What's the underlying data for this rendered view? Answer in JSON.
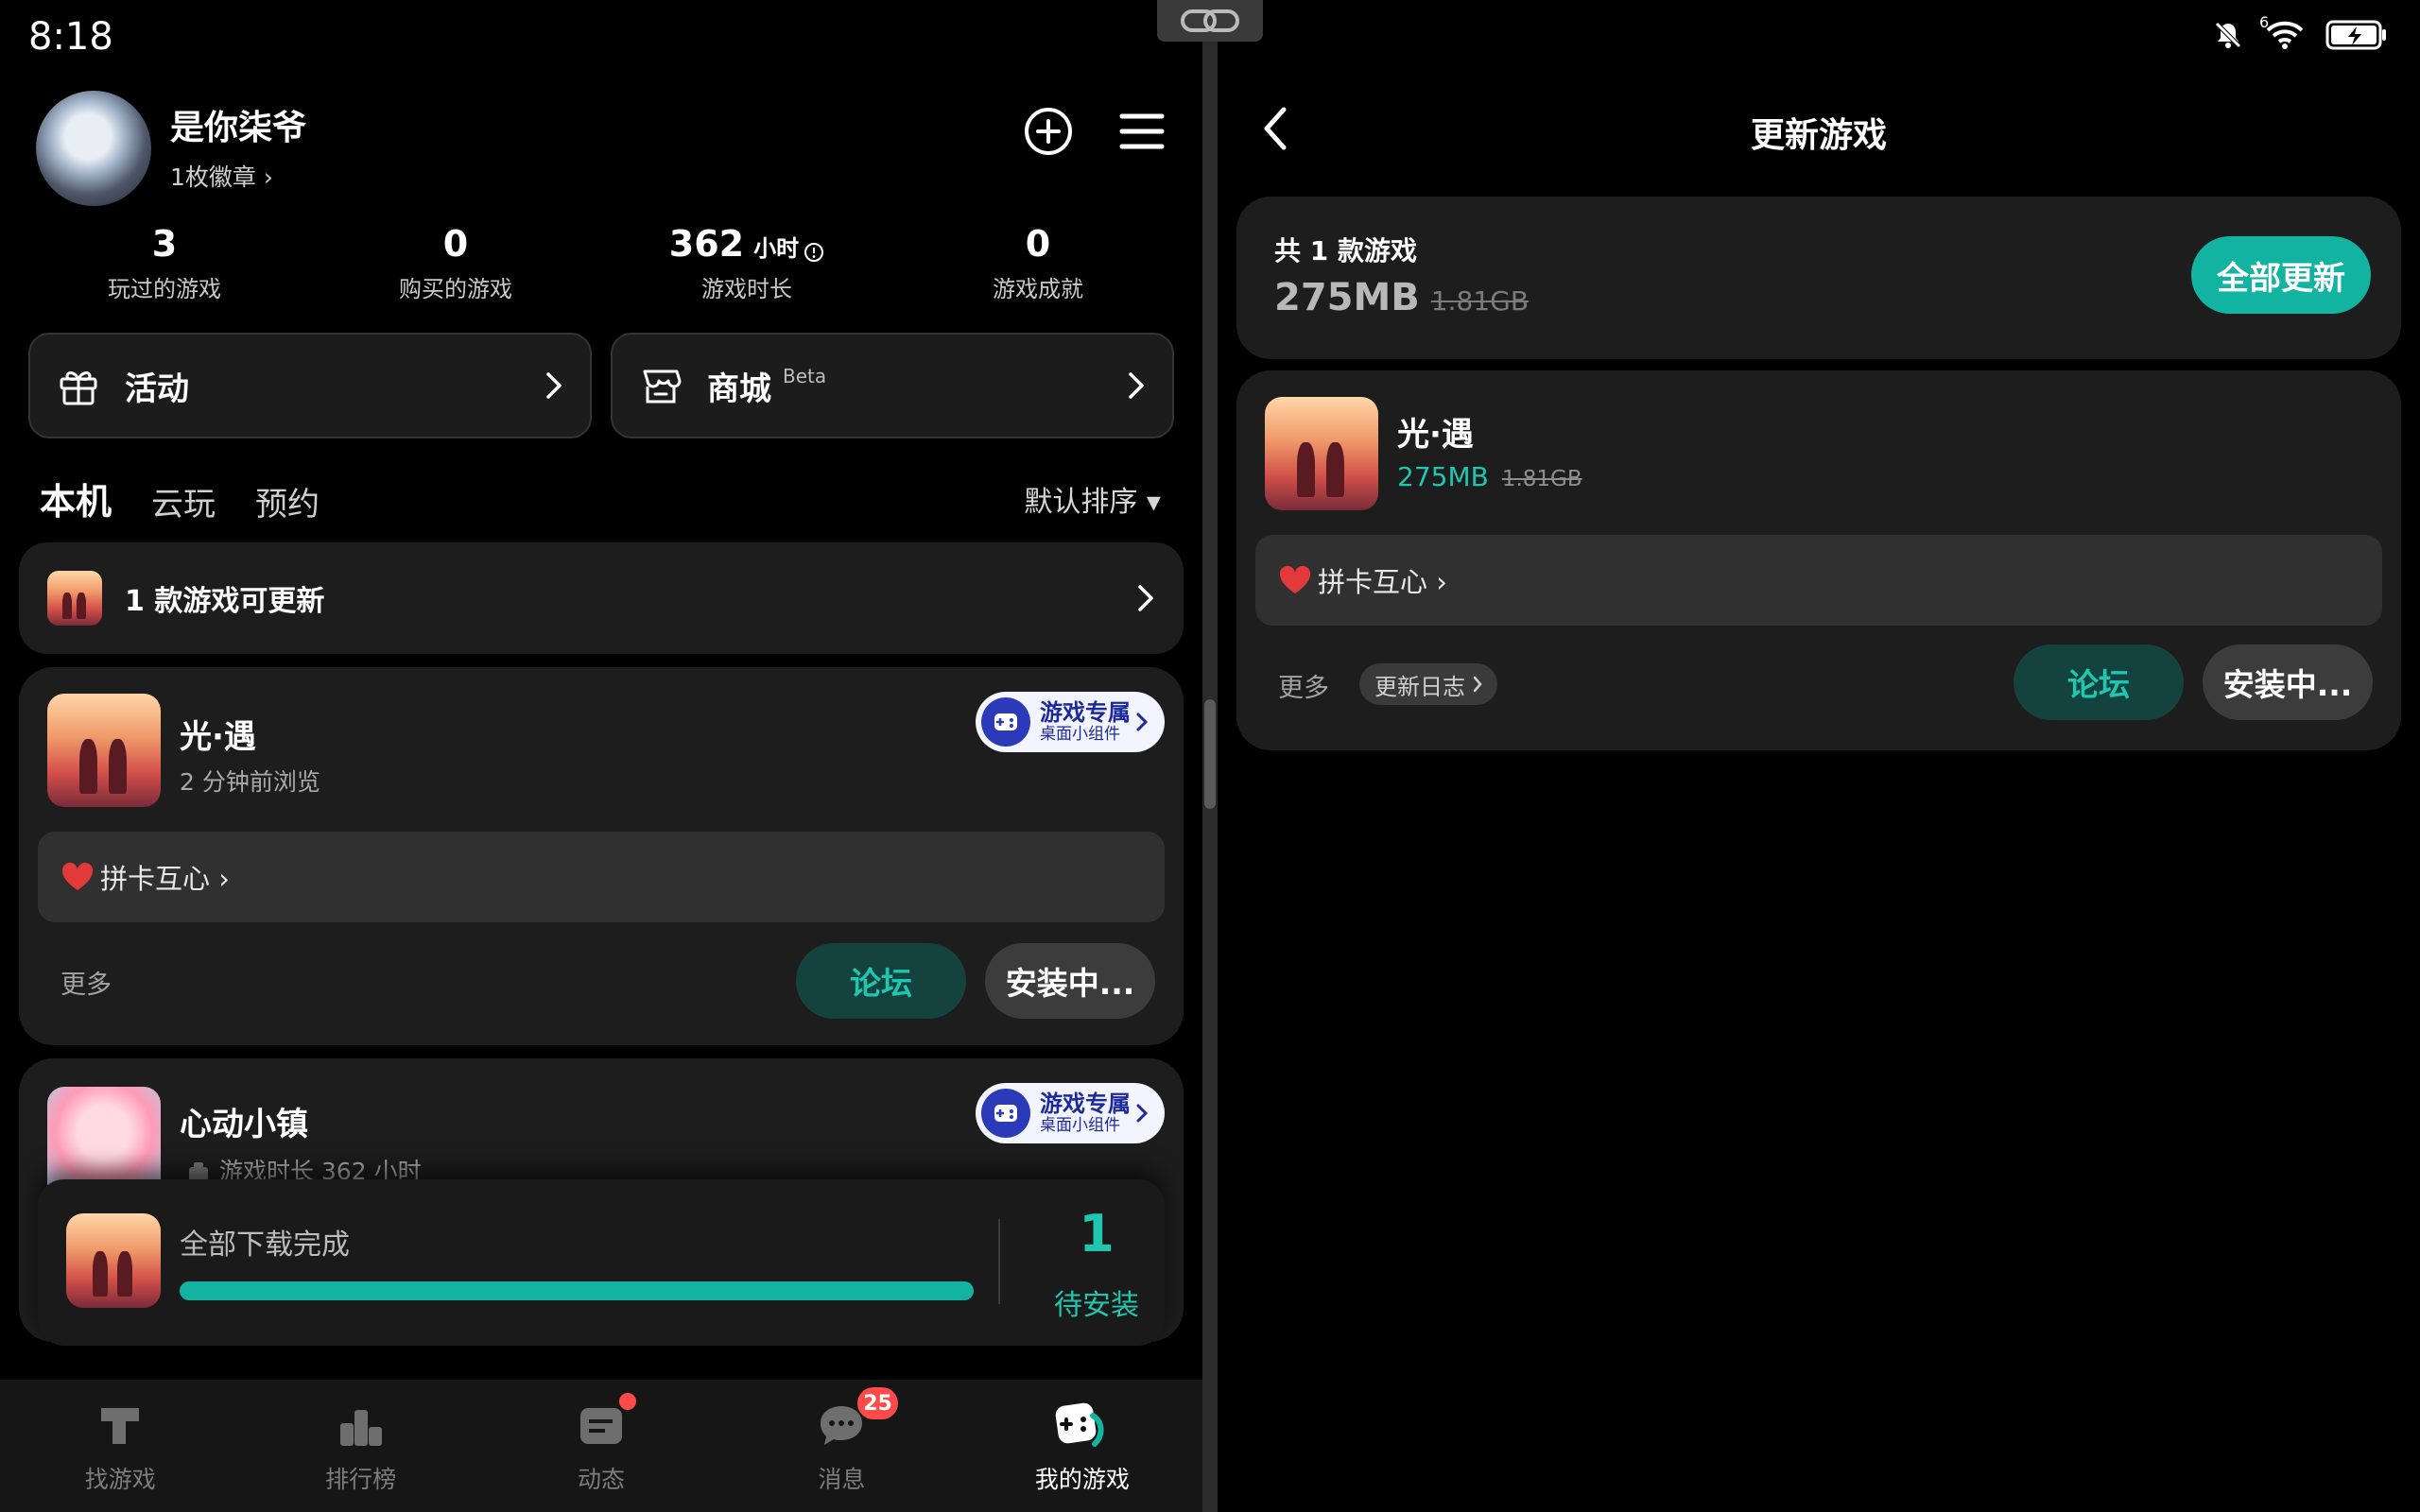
{
  "status": {
    "time": "8:18",
    "wifi_label": "6",
    "icons": [
      "mute-icon",
      "wifi-icon",
      "battery-charging-icon"
    ]
  },
  "colors": {
    "accent": "#13b3a1",
    "card": "#1d1d1d",
    "background": "#000000",
    "badge": "#ff4a4a"
  },
  "profile": {
    "name": "是你柒爷",
    "badges_link": "1枚徽章 ›"
  },
  "stats": [
    {
      "value": "3",
      "unit": "",
      "label": "玩过的游戏"
    },
    {
      "value": "0",
      "unit": "",
      "label": "购买的游戏"
    },
    {
      "value": "362",
      "unit": "小时",
      "label": "游戏时长"
    },
    {
      "value": "0",
      "unit": "",
      "label": "游戏成就"
    }
  ],
  "quick": {
    "activity_label": "活动",
    "shop_label": "商城",
    "shop_beta": "Beta"
  },
  "tabs": [
    "本机",
    "云玩",
    "预约"
  ],
  "sort_label": "默认排序 ▾",
  "update_banner": "1 款游戏可更新",
  "games": [
    {
      "name": "光·遇",
      "subtitle": "2 分钟前浏览",
      "checkin": "拼卡互心 ›",
      "more": "更多",
      "forum": "论坛",
      "install": "安装中...",
      "widget_title": "游戏专属",
      "widget_sub": "桌面小组件"
    },
    {
      "name": "心动小镇",
      "subtitle": "游戏时长 362 小时",
      "widget_title": "游戏专属",
      "widget_sub": "桌面小组件"
    }
  ],
  "download": {
    "title": "全部下载完成",
    "progress": 1.0,
    "count": "1",
    "label": "待安装"
  },
  "nav": [
    {
      "label": "找游戏",
      "icon": "find-games-icon"
    },
    {
      "label": "排行榜",
      "icon": "ranking-icon"
    },
    {
      "label": "动态",
      "icon": "feed-icon"
    },
    {
      "label": "消息",
      "icon": "message-icon",
      "badge": "25"
    },
    {
      "label": "我的游戏",
      "icon": "my-games-icon"
    }
  ],
  "right": {
    "title": "更新游戏",
    "summary_title": "共 1 款游戏",
    "size": "275MB",
    "size_old": "1.81GB",
    "update_all": "全部更新",
    "game": {
      "name": "光·遇",
      "size": "275MB",
      "size_old": "1.81GB",
      "checkin": "拼卡互心 ›",
      "more": "更多",
      "changelog": "更新日志",
      "forum": "论坛",
      "install": "安装中..."
    }
  }
}
